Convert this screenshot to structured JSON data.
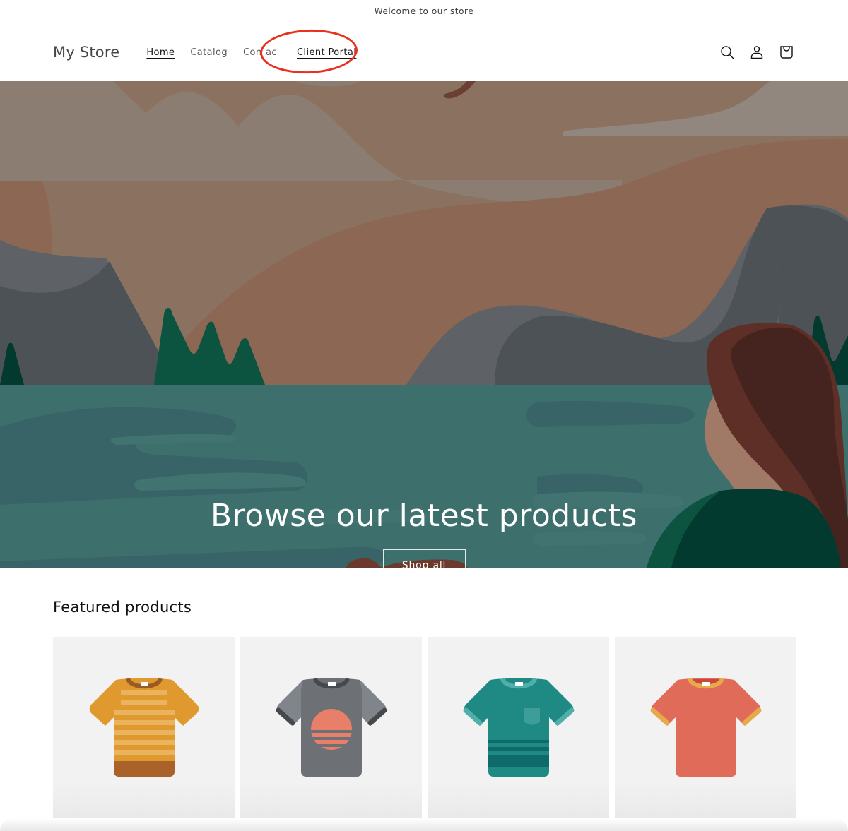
{
  "announcement": {
    "text": "Welcome to our store"
  },
  "header": {
    "logo": "My Store",
    "nav": [
      {
        "label": "Home",
        "active": true
      },
      {
        "label": "Catalog",
        "active": false
      },
      {
        "label": "Contact",
        "active": false,
        "visible_text": "Contac"
      },
      {
        "label": "Client Portal",
        "active": false
      }
    ],
    "icons": [
      "search-icon",
      "account-icon",
      "cart-icon"
    ],
    "annotation": {
      "type": "red-ellipse",
      "target": "Client Portal",
      "color": "#e8321f"
    }
  },
  "hero": {
    "title": "Browse our latest products",
    "button_label": "Shop all",
    "colors": {
      "sky": "#8b7260",
      "cloud": "#8c7d73",
      "hill": "#8c6753",
      "mountain_light": "#5e6166",
      "mountain_dark": "#4d5257",
      "tree": "#0d5440",
      "water": "#3d6f6d",
      "water_dark": "#396467",
      "hair": "#452520",
      "shirt": "#033a2f"
    }
  },
  "featured": {
    "title": "Featured products",
    "products": [
      {
        "name": "striped-orange-tshirt",
        "color": "#e0992f"
      },
      {
        "name": "gray-sunset-tshirt",
        "color": "#6d7075"
      },
      {
        "name": "teal-pocket-tshirt",
        "color": "#1f8a84"
      },
      {
        "name": "coral-ringer-tshirt",
        "color": "#e06b58"
      }
    ]
  }
}
